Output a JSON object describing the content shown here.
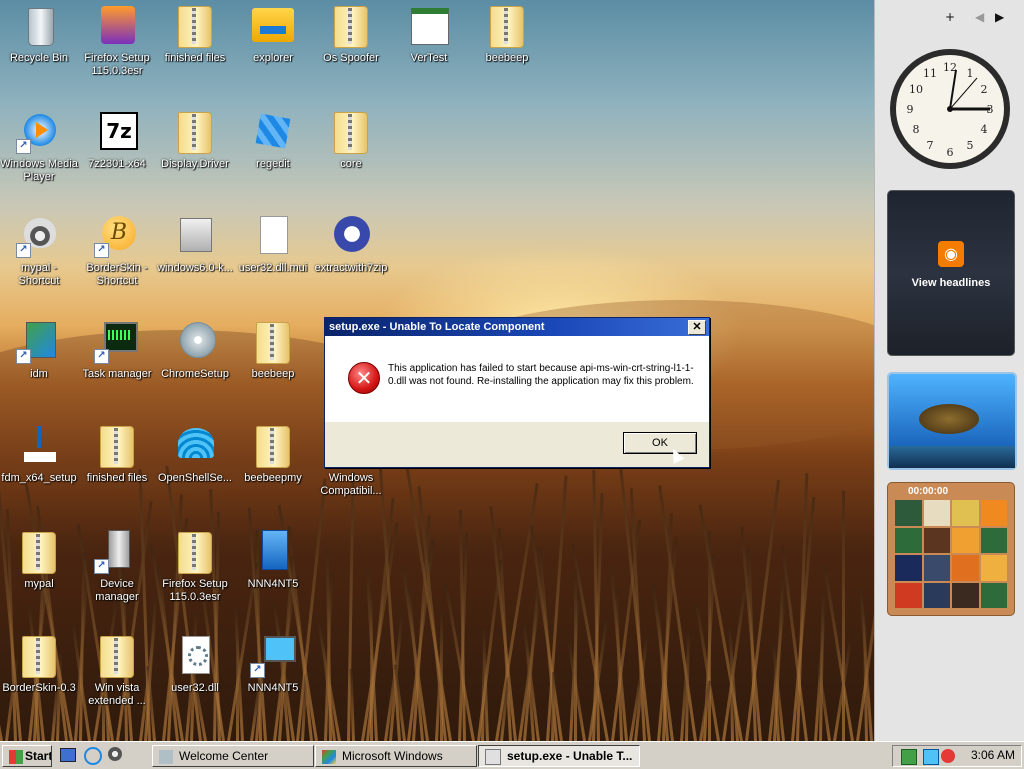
{
  "desktop": {
    "icons": [
      {
        "label": "Recycle Bin"
      },
      {
        "label": "Firefox Setup 115.0.3esr"
      },
      {
        "label": "finished files"
      },
      {
        "label": "explorer"
      },
      {
        "label": "Os Spoofer"
      },
      {
        "label": "VerTest"
      },
      {
        "label": "beebeep"
      },
      {
        "label": "Windows Media Player"
      },
      {
        "label": "7z2301-x64"
      },
      {
        "label": "Display.Driver"
      },
      {
        "label": "regedit"
      },
      {
        "label": "core"
      },
      {
        "label": "mypal - Shortcut"
      },
      {
        "label": "BorderSkin - Shortcut"
      },
      {
        "label": "windows6.0-k..."
      },
      {
        "label": "user32.dll.mui"
      },
      {
        "label": "extractwith7zip"
      },
      {
        "label": "idm"
      },
      {
        "label": "Task manager"
      },
      {
        "label": "ChromeSetup"
      },
      {
        "label": "beebeep"
      },
      {
        "label": "fdm_x64_setup"
      },
      {
        "label": "finished files"
      },
      {
        "label": "OpenShellSe..."
      },
      {
        "label": "beebeepmy"
      },
      {
        "label": "Windows Compatibil..."
      },
      {
        "label": "mypal"
      },
      {
        "label": "Device manager"
      },
      {
        "label": "Firefox Setup 115.0.3esr"
      },
      {
        "label": "NNN4NT5"
      },
      {
        "label": "BorderSkin-0.3"
      },
      {
        "label": "Win vista extended ..."
      },
      {
        "label": "user32.dll"
      },
      {
        "label": "NNN4NT5"
      }
    ]
  },
  "sidebar": {
    "add": "+",
    "prev": "◀",
    "next": "▶",
    "feeds_label": "View headlines",
    "puzzle_timer": "00:00:00"
  },
  "dialog": {
    "title": "setup.exe - Unable To Locate Component",
    "message": "This application has failed to start because api-ms-win-crt-string-l1-1-0.dll was not found. Re-installing the application may fix this problem.",
    "ok": "OK",
    "close": "✕",
    "error_icon": "✕"
  },
  "taskbar": {
    "start": "Start",
    "buttons": [
      {
        "label": "Welcome Center"
      },
      {
        "label": "Microsoft Windows"
      },
      {
        "label": "setup.exe - Unable T..."
      }
    ],
    "clock": "3:06 AM"
  }
}
